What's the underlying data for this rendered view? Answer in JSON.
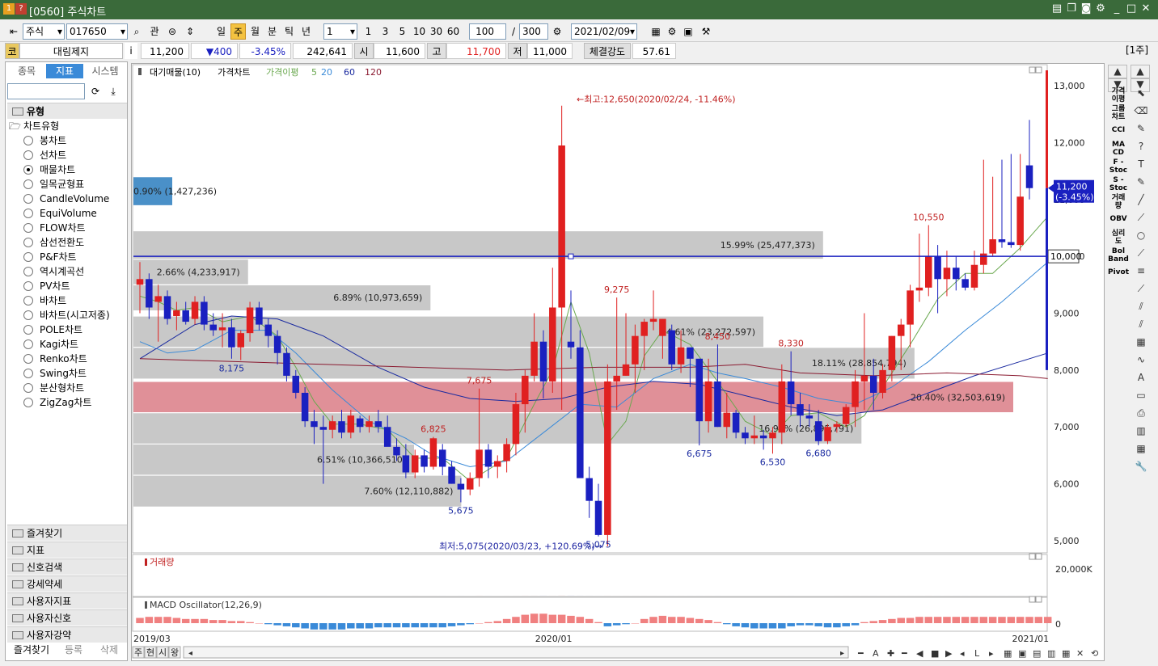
{
  "window": {
    "code_badge": "1",
    "help_badge": "?",
    "title": "[0560] 주식차트"
  },
  "toolbar": {
    "market": "주식",
    "code": "017650",
    "tag": "관",
    "periods": [
      "일",
      "주",
      "월",
      "분",
      "틱",
      "년"
    ],
    "selected_period": "주",
    "interval_select": "1",
    "interval_buttons": [
      "1",
      "3",
      "5",
      "10",
      "30",
      "60"
    ],
    "count": "100",
    "total": "300",
    "date": "2021/02/09",
    "unit_badge": "[1주]"
  },
  "quote": {
    "market_badge": "코",
    "name": "대림제지",
    "info": "i",
    "price": "11,200",
    "change": "▼400",
    "change_pct": "-3.45%",
    "volume": "242,641",
    "open_label": "시",
    "open": "11,600",
    "high_label": "고",
    "high": "11,700",
    "low_label": "저",
    "low": "11,000",
    "strength_label": "체결강도",
    "strength": "57.61"
  },
  "left_panel": {
    "tabs": [
      "종목",
      "지표",
      "시스템"
    ],
    "selected_tab": "지표",
    "section": "유형",
    "group": "차트유형",
    "chart_types": [
      "봉차트",
      "선차트",
      "매물차트",
      "일목균형표",
      "CandleVolume",
      "EquiVolume",
      "FLOW차트",
      "삼선전환도",
      "P&F차트",
      "역시계곡선",
      "PV차트",
      "바차트",
      "바차트(시고저종)",
      "POLE차트",
      "Kagi차트",
      "Renko차트",
      "Swing차트",
      "분산형차트",
      "ZigZag차트"
    ],
    "selected_type": "매물차트",
    "folders": [
      "즐겨찾기",
      "지표",
      "신호검색",
      "강세약세",
      "사용자지표",
      "사용자신호",
      "사용자강약"
    ],
    "bottom_tabs": [
      "즐겨찾기",
      "등록",
      "삭제"
    ]
  },
  "chart": {
    "legend": [
      "대기매물(10)",
      "가격차트",
      "가격이평",
      "5",
      "20",
      "60",
      "120"
    ],
    "legend_colors": {
      "ma5": "#6aa84f",
      "ma20": "#3a8ad8",
      "ma60": "#1a2aa0",
      "ma120": "#8a1a30",
      "up": "#e02020",
      "down": "#1a20c0"
    },
    "high_note": "←최고:12,650(2020/02/24, -11.46%)",
    "low_note": "최저:5,075(2020/03/23, +120.69%)→",
    "current_price": "11,200",
    "current_change": "(-3.45%)",
    "crosshair_price": "10,000",
    "price_labels": [
      "8,175",
      "7,675",
      "6,825",
      "5,675",
      "9,275",
      "5,075",
      "8,450",
      "8,330",
      "6,675",
      "6,530",
      "6,680",
      "10,550"
    ],
    "volume_profile": [
      {
        "text": "0.90% (1,427,236)"
      },
      {
        "text": "15.99% (25,477,373)"
      },
      {
        "text": "2.66% (4,233,917)"
      },
      {
        "text": "6.89% (10,973,659)"
      },
      {
        "text": "14.61% (23,272,597)"
      },
      {
        "text": "18.11% (28,854,794)"
      },
      {
        "text": "20.40% (32,503,619)"
      },
      {
        "text": "16.91% (26,895,791)"
      },
      {
        "text": "6.51% (10,366,510)"
      },
      {
        "text": "7.60% (12,110,882)"
      }
    ],
    "y_ticks": [
      "13,000",
      "12,000",
      "11,000",
      "10,000",
      "9,000",
      "8,000",
      "7,000",
      "6,000",
      "5,000"
    ],
    "x_ticks": [
      "2019/03",
      "2020/01",
      "2021/01"
    ],
    "volume_title": "거래량",
    "volume_tick": "20,000K",
    "macd_title": "MACD Oscillator(12,26,9)",
    "macd_tick": "0",
    "nav_buttons": [
      "주",
      "현",
      "시",
      "왕"
    ]
  },
  "chart_data": {
    "type": "candlestick",
    "title": "",
    "ylim": [
      4800,
      13300
    ],
    "x_start": "2019/02",
    "x_period": "week",
    "candles": [
      [
        9500,
        9900,
        9000,
        9600
      ],
      [
        9600,
        9700,
        8900,
        9100
      ],
      [
        9200,
        9500,
        8500,
        9300
      ],
      [
        9300,
        9400,
        8800,
        8900
      ],
      [
        8950,
        9200,
        8700,
        9050
      ],
      [
        9050,
        9200,
        8800,
        8850
      ],
      [
        8900,
        9300,
        8800,
        9200
      ],
      [
        9200,
        9300,
        8700,
        8800
      ],
      [
        8800,
        9000,
        8600,
        8700
      ],
      [
        8700,
        9000,
        8400,
        8750
      ],
      [
        8750,
        8900,
        8200,
        8400
      ],
      [
        8400,
        8700,
        8175,
        8650
      ],
      [
        8650,
        9200,
        8500,
        9100
      ],
      [
        9100,
        9200,
        8700,
        8800
      ],
      [
        8800,
        8900,
        8400,
        8600
      ],
      [
        8600,
        8700,
        8100,
        8300
      ],
      [
        8300,
        8400,
        7800,
        7900
      ],
      [
        7900,
        8000,
        7500,
        7600
      ],
      [
        7600,
        7700,
        7000,
        7100
      ],
      [
        7100,
        7300,
        6700,
        7000
      ],
      [
        7000,
        7200,
        6000,
        6950
      ],
      [
        6950,
        7200,
        6800,
        7100
      ],
      [
        7100,
        7300,
        6800,
        6900
      ],
      [
        6900,
        7300,
        6800,
        7200
      ],
      [
        7150,
        7200,
        6900,
        7000
      ],
      [
        7000,
        7200,
        6900,
        7100
      ],
      [
        7100,
        7300,
        6900,
        7000
      ],
      [
        7000,
        7200,
        6700,
        6650
      ],
      [
        6650,
        6800,
        6400,
        6500
      ],
      [
        6500,
        6700,
        6100,
        6200
      ],
      [
        6200,
        6600,
        6100,
        6500
      ],
      [
        6500,
        6600,
        6200,
        6300
      ],
      [
        6300,
        6825,
        6250,
        6800
      ],
      [
        6600,
        6700,
        6150,
        6300
      ],
      [
        6300,
        6400,
        6000,
        6000
      ],
      [
        6000,
        6100,
        5675,
        5900
      ],
      [
        5900,
        6200,
        5800,
        6100
      ],
      [
        6100,
        7675,
        5950,
        6600
      ],
      [
        6600,
        6700,
        6100,
        6300
      ],
      [
        6300,
        6500,
        6100,
        6400
      ],
      [
        6400,
        6800,
        6200,
        6700
      ],
      [
        6700,
        7600,
        6500,
        7400
      ],
      [
        7400,
        8000,
        6900,
        7900
      ],
      [
        7900,
        9000,
        7800,
        8500
      ],
      [
        8500,
        8700,
        7500,
        7800
      ],
      [
        7800,
        9800,
        7600,
        9100
      ],
      [
        9100,
        12650,
        7300,
        11950
      ],
      [
        8500,
        9400,
        8200,
        8400
      ],
      [
        8400,
        8700,
        6100,
        6100
      ],
      [
        6100,
        6300,
        5400,
        5700
      ],
      [
        5700,
        6000,
        5075,
        5100
      ],
      [
        5100,
        8100,
        4900,
        7800
      ],
      [
        7800,
        9275,
        7300,
        7900
      ],
      [
        7900,
        9000,
        7900,
        8100
      ],
      [
        8100,
        8800,
        7600,
        8600
      ],
      [
        8600,
        8900,
        8000,
        8850
      ],
      [
        8850,
        9400,
        8700,
        8900
      ],
      [
        8600,
        8900,
        8200,
        8900
      ],
      [
        8700,
        8800,
        8000,
        8100
      ],
      [
        8100,
        8700,
        7950,
        8400
      ],
      [
        8400,
        8400,
        7700,
        8200
      ],
      [
        8200,
        8200,
        6675,
        7100
      ],
      [
        7100,
        8200,
        6900,
        7800
      ],
      [
        7800,
        8450,
        7000,
        7000
      ],
      [
        7000,
        7600,
        6800,
        7250
      ],
      [
        7250,
        7300,
        6800,
        6900
      ],
      [
        6900,
        7000,
        6700,
        6800
      ],
      [
        6800,
        7200,
        6700,
        6850
      ],
      [
        6850,
        6950,
        6600,
        6800
      ],
      [
        6800,
        7000,
        6530,
        6900
      ],
      [
        6900,
        8100,
        6700,
        7800
      ],
      [
        7800,
        8330,
        7200,
        7400
      ],
      [
        7400,
        7600,
        7000,
        7200
      ],
      [
        7200,
        7400,
        7000,
        7150
      ],
      [
        7100,
        7300,
        6680,
        6750
      ],
      [
        6750,
        7050,
        6700,
        7000
      ],
      [
        7000,
        7100,
        6900,
        7050
      ],
      [
        7050,
        7400,
        7000,
        7350
      ],
      [
        7350,
        8000,
        7000,
        7800
      ],
      [
        7800,
        9000,
        7300,
        7900
      ],
      [
        7900,
        8200,
        7300,
        7600
      ],
      [
        7600,
        8100,
        7500,
        8000
      ],
      [
        8000,
        8600,
        7800,
        8600
      ],
      [
        8600,
        8900,
        8000,
        8800
      ],
      [
        8800,
        9500,
        8400,
        9400
      ],
      [
        9400,
        10400,
        9200,
        9450
      ],
      [
        9450,
        10550,
        9300,
        10000
      ],
      [
        10000,
        10200,
        9000,
        9600
      ],
      [
        9600,
        10100,
        9300,
        9800
      ],
      [
        9800,
        10000,
        9400,
        9600
      ],
      [
        9600,
        9700,
        9400,
        9450
      ],
      [
        9450,
        10100,
        9400,
        9850
      ],
      [
        9850,
        11700,
        9700,
        10050
      ],
      [
        10050,
        11400,
        10000,
        10300
      ],
      [
        10300,
        11700,
        10150,
        10250
      ],
      [
        10250,
        11800,
        10150,
        10200
      ],
      [
        10200,
        11800,
        10100,
        11050
      ],
      [
        11600,
        12400,
        11000,
        11200
      ]
    ],
    "ma": {
      "5": [
        [
          0,
          9300
        ],
        [
          2,
          9200
        ],
        [
          4,
          9050
        ],
        [
          6,
          9100
        ],
        [
          9,
          8850
        ],
        [
          12,
          8950
        ],
        [
          15,
          8600
        ],
        [
          17,
          8050
        ],
        [
          19,
          7450
        ],
        [
          21,
          7050
        ],
        [
          24,
          7050
        ],
        [
          27,
          6950
        ],
        [
          30,
          6450
        ],
        [
          33,
          6450
        ],
        [
          36,
          6050
        ],
        [
          38,
          6250
        ],
        [
          40,
          6450
        ],
        [
          43,
          7400
        ],
        [
          45,
          8000
        ],
        [
          47,
          9200
        ],
        [
          49,
          8300
        ],
        [
          51,
          6700
        ],
        [
          53,
          7100
        ],
        [
          55,
          8250
        ],
        [
          57,
          8700
        ],
        [
          60,
          8450
        ],
        [
          63,
          7800
        ],
        [
          66,
          7100
        ],
        [
          69,
          6850
        ],
        [
          71,
          7200
        ],
        [
          74,
          7250
        ],
        [
          77,
          7000
        ],
        [
          79,
          7200
        ],
        [
          81,
          7700
        ],
        [
          84,
          8450
        ],
        [
          87,
          9250
        ],
        [
          90,
          9700
        ],
        [
          93,
          9700
        ],
        [
          96,
          10150
        ],
        [
          99,
          10700
        ]
      ],
      "20": [
        [
          0,
          8500
        ],
        [
          3,
          8300
        ],
        [
          6,
          8350
        ],
        [
          10,
          8700
        ],
        [
          14,
          8700
        ],
        [
          17,
          8300
        ],
        [
          21,
          7650
        ],
        [
          25,
          7100
        ],
        [
          29,
          6800
        ],
        [
          32,
          6500
        ],
        [
          36,
          6300
        ],
        [
          40,
          6400
        ],
        [
          44,
          6900
        ],
        [
          48,
          7400
        ],
        [
          52,
          7350
        ],
        [
          56,
          7850
        ],
        [
          60,
          8100
        ],
        [
          63,
          7950
        ],
        [
          66,
          7850
        ],
        [
          70,
          7700
        ],
        [
          74,
          7500
        ],
        [
          78,
          7400
        ],
        [
          82,
          7700
        ],
        [
          86,
          8150
        ],
        [
          90,
          8700
        ],
        [
          94,
          9200
        ],
        [
          99,
          9900
        ]
      ],
      "60": [
        [
          0,
          8200
        ],
        [
          6,
          8800
        ],
        [
          10,
          8950
        ],
        [
          15,
          8900
        ],
        [
          20,
          8600
        ],
        [
          26,
          8050
        ],
        [
          31,
          7700
        ],
        [
          36,
          7500
        ],
        [
          41,
          7450
        ],
        [
          46,
          7500
        ],
        [
          51,
          7700
        ],
        [
          56,
          7800
        ],
        [
          61,
          7750
        ],
        [
          66,
          7550
        ],
        [
          71,
          7350
        ],
        [
          76,
          7200
        ],
        [
          81,
          7300
        ],
        [
          86,
          7600
        ],
        [
          91,
          7900
        ],
        [
          96,
          8150
        ],
        [
          99,
          8300
        ]
      ],
      "120": [
        [
          0,
          8200
        ],
        [
          10,
          8150
        ],
        [
          20,
          8100
        ],
        [
          30,
          8050
        ],
        [
          40,
          8000
        ],
        [
          50,
          8050
        ],
        [
          60,
          8050
        ],
        [
          66,
          8100
        ],
        [
          72,
          7950
        ],
        [
          80,
          7900
        ],
        [
          88,
          7950
        ],
        [
          96,
          7900
        ],
        [
          99,
          7850
        ]
      ]
    },
    "volume_profile_bands": [
      {
        "pct": 0.9,
        "volume": 1427236
      },
      {
        "pct": 15.99,
        "volume": 25477373
      },
      {
        "pct": 2.66,
        "volume": 4233917
      },
      {
        "pct": 6.89,
        "volume": 10973659
      },
      {
        "pct": 14.61,
        "volume": 23272597
      },
      {
        "pct": 18.11,
        "volume": 28854794
      },
      {
        "pct": 20.4,
        "volume": 32503619
      },
      {
        "pct": 16.91,
        "volume": 26895791
      },
      {
        "pct": 6.51,
        "volume": 10366510
      },
      {
        "pct": 7.6,
        "volume": 12110882
      }
    ],
    "volume_max": 20000,
    "volume": [
      1,
      1,
      1,
      1,
      1,
      1,
      1,
      1,
      1,
      1,
      1,
      1,
      2,
      1,
      1,
      1,
      1,
      1,
      1,
      1,
      2,
      1,
      1,
      1,
      1,
      1,
      1,
      1,
      1,
      1,
      2,
      1,
      2,
      2,
      1,
      2,
      1,
      6,
      3,
      1,
      2,
      4,
      7,
      9,
      12,
      5,
      20,
      16,
      7,
      5,
      4,
      5,
      4,
      2,
      3,
      2,
      2,
      2,
      2,
      2,
      2,
      2,
      2,
      2,
      1,
      1,
      1,
      1,
      1,
      1,
      2,
      2,
      1,
      1,
      1,
      1,
      2,
      2,
      3,
      3,
      2,
      2,
      3,
      4,
      4,
      4,
      5,
      4,
      3,
      3,
      2,
      2,
      4,
      4,
      4,
      4,
      3,
      4
    ],
    "macd": [
      5,
      6,
      6,
      6,
      5,
      4,
      4,
      4,
      3,
      3,
      2,
      2,
      1,
      0,
      -1,
      -2,
      -3,
      -4,
      -5,
      -6,
      -6,
      -6,
      -6,
      -5,
      -5,
      -5,
      -4,
      -4,
      -4,
      -4,
      -4,
      -4,
      -4,
      -4,
      -3,
      -2,
      -1,
      0,
      1,
      2,
      4,
      6,
      8,
      9,
      9,
      8,
      8,
      7,
      6,
      4,
      1,
      -3,
      -2,
      -1,
      0,
      4,
      6,
      7,
      6,
      6,
      5,
      4,
      3,
      1,
      -1,
      -3,
      -4,
      -5,
      -5,
      -5,
      -5,
      -3,
      -2,
      -2,
      -3,
      -4,
      -4,
      -3,
      -2,
      1,
      2,
      3,
      4,
      5,
      5,
      6,
      6,
      6,
      6,
      6,
      6,
      6,
      6,
      6,
      6,
      6,
      6,
      6,
      6,
      6
    ]
  }
}
